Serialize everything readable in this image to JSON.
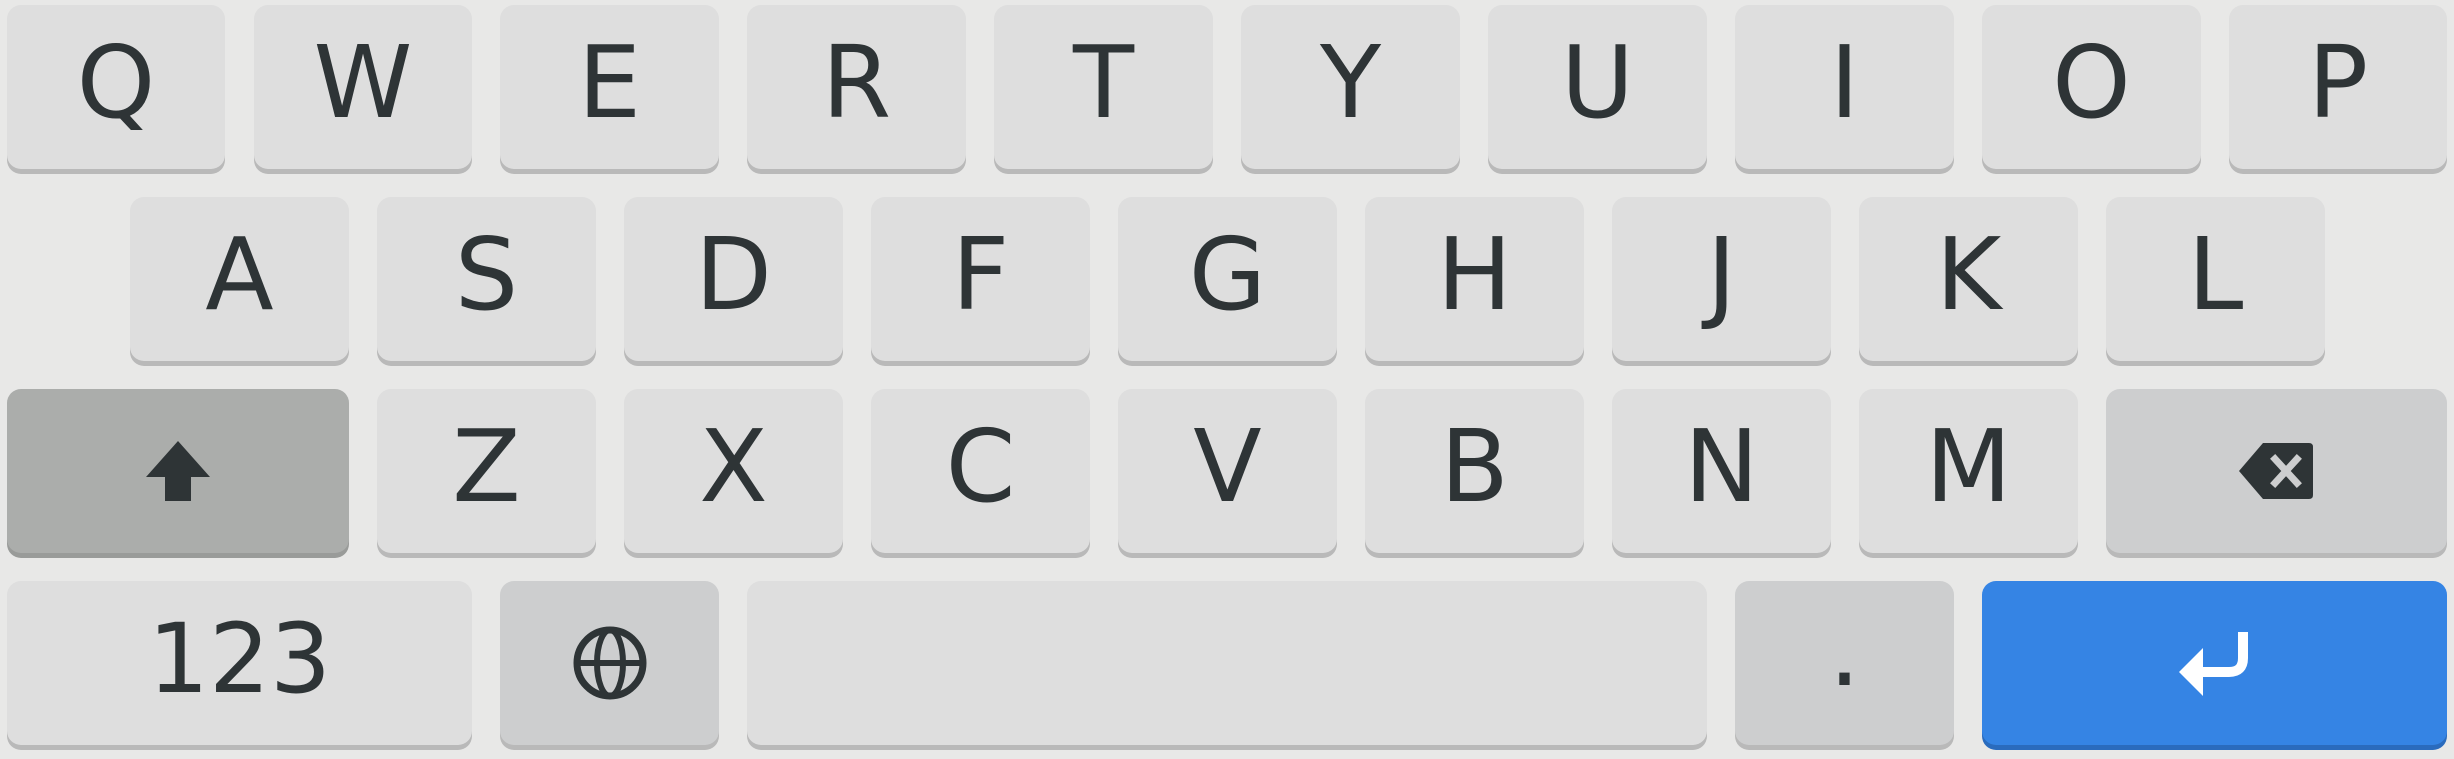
{
  "keyboard": {
    "row1": [
      "Q",
      "W",
      "E",
      "R",
      "T",
      "Y",
      "U",
      "I",
      "O",
      "P"
    ],
    "row2": [
      "A",
      "S",
      "D",
      "F",
      "G",
      "H",
      "J",
      "K",
      "L"
    ],
    "row3": [
      "Z",
      "X",
      "C",
      "V",
      "B",
      "N",
      "M"
    ],
    "numbers_label": "123",
    "period_label": ".",
    "icons": {
      "shift": "shift-arrow-icon",
      "backspace": "backspace-icon",
      "language": "globe-icon",
      "enter": "enter-return-icon"
    },
    "colors": {
      "background": "#e8e8e7",
      "key": "#dedede",
      "key_dark": "#cdcecf",
      "shift_active": "#abadab",
      "enter": "#3584e4",
      "text": "#2e3436"
    }
  }
}
